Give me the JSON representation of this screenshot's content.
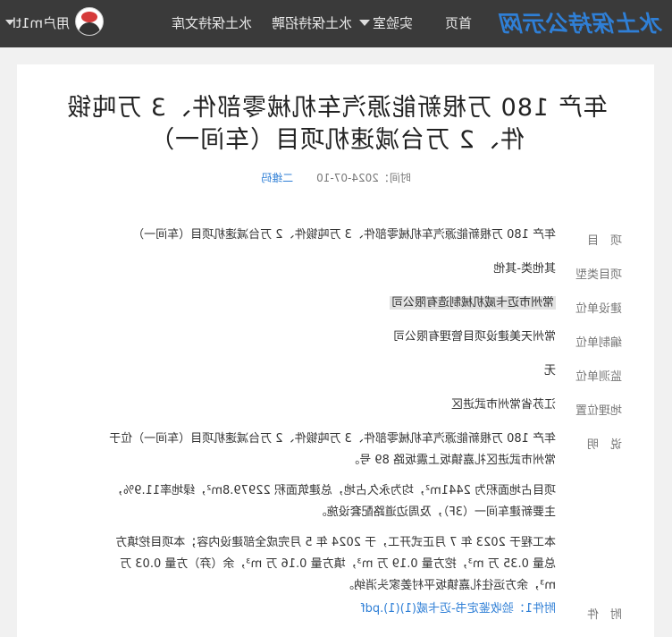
{
  "nav": {
    "brand": "水土保持公示网",
    "home": "首页",
    "lab": "实验室",
    "recruit": "水土保持招聘",
    "library": "水土保持文库",
    "user": "用户m1tl"
  },
  "article": {
    "title": "年产 180 万根新能源汽车机械零部件、3 万吨锻件、2 万台减速机项目（车间一）",
    "time_label": "时间：",
    "time": "2024-07-10",
    "qr_label": "二维码"
  },
  "fields": [
    {
      "label": "项　目",
      "value": "年产 180 万根新能源汽车机械零部件、3 万吨锻件、2 万台减速机项目（车间一）"
    },
    {
      "label": "项目类型",
      "value": "其他类-其他"
    },
    {
      "label": "建设单位",
      "value": "常州市迈卡威机械制造有限公司"
    },
    {
      "label": "编制单位",
      "value": "常州天美建设项目管理有限公司"
    },
    {
      "label": "监测单位",
      "value": "无"
    },
    {
      "label": "地理位置",
      "value": "江苏省常州市武进区"
    }
  ],
  "description": {
    "label": "说　明",
    "paragraphs": [
      "年产 180 万根新能源汽车机械零部件、3 万吨锻件、2 万台减速机项目（车间一）位于常州市武进区礼嘉镇坂上震坂路 89 号。",
      "项目占地面积为 2441m²，均为永久占地，总建筑面积 22979.8m²，绿地率11.9%，主要新建车间一（3F），及周边道路配套设施。",
      "本工程于 2023 年 7 月正式开工，于 2024 年 5 月完成全部建设内容；本项目挖填方总量 0.35 万 m³，挖方量 0.19 万 m³，填方量 0.16 万 m³，余（弃）方量 0.03 万 m³，余方运往礼嘉镇坂平村姜家头消纳。"
    ]
  },
  "attachment": {
    "label": "附　件",
    "link": "附件1：验收鉴定书-迈卡威(1)(1).pdf"
  }
}
